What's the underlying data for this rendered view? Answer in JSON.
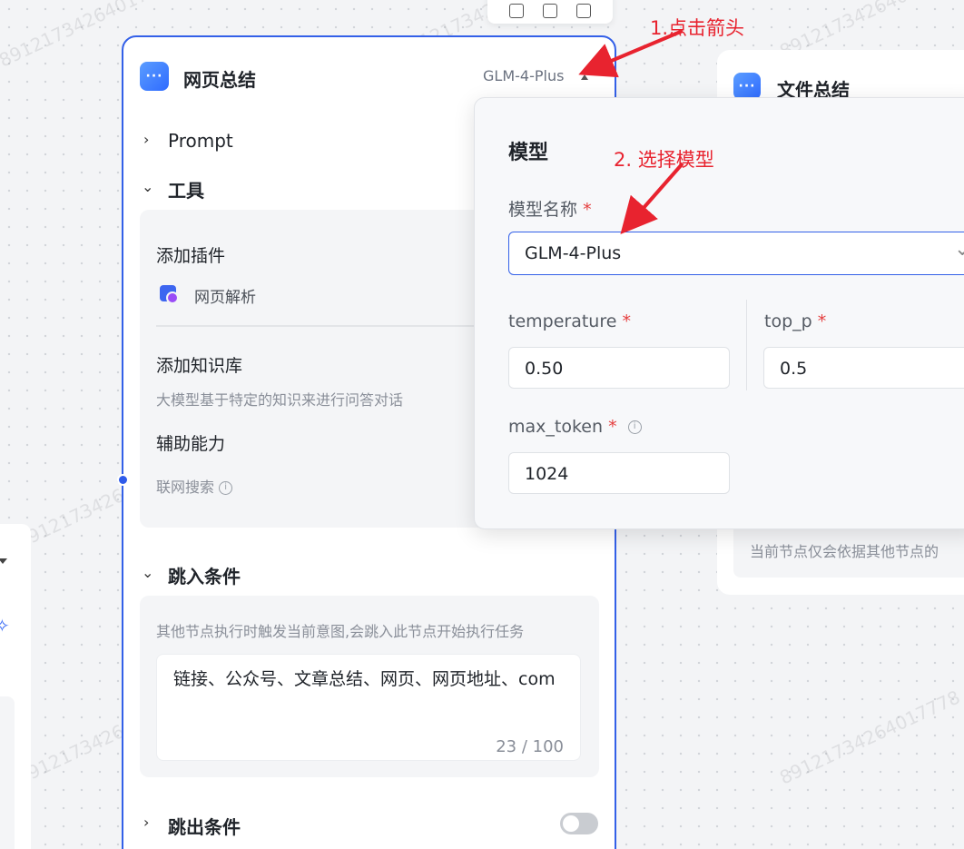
{
  "node_card": {
    "title": "网页总结",
    "model": "GLM-4-Plus",
    "prompt_section": "Prompt",
    "tools_section": "工具",
    "add_plugin": "添加插件",
    "plugin_name": "网页解析",
    "add_knowledge": "添加知识库",
    "knowledge_desc": "大模型基于特定的知识来进行问答对话",
    "assist_title": "辅助能力",
    "web_search": "联网搜索",
    "jump_in_section": "跳入条件",
    "jump_in_desc": "其他节点执行时触发当前意图,会跳入此节点开始执行任务",
    "jump_in_value": "链接、公众号、文章总结、网页、网页地址、com",
    "char_counter": "23 / 100",
    "jump_out_section": "跳出条件",
    "jump_out_enabled": false
  },
  "file_card": {
    "title": "文件总结",
    "desc": "当前节点仅会依据其他节点的"
  },
  "model_popup": {
    "title": "模型",
    "model_name_label": "模型名称",
    "model_name_value": "GLM-4-Plus",
    "temperature_label": "temperature",
    "temperature_value": "0.50",
    "top_p_label": "top_p",
    "top_p_value": "0.5",
    "max_token_label": "max_token",
    "max_token_value": "1024",
    "required_mark": "*"
  },
  "annotations": {
    "step1": "1.点击箭头",
    "step2": "2. 选择模型",
    "color": "#e8232f"
  },
  "watermark": "891217342640177​78",
  "colors": {
    "accent": "#3360e8",
    "canvas": "#f3f4f6"
  }
}
